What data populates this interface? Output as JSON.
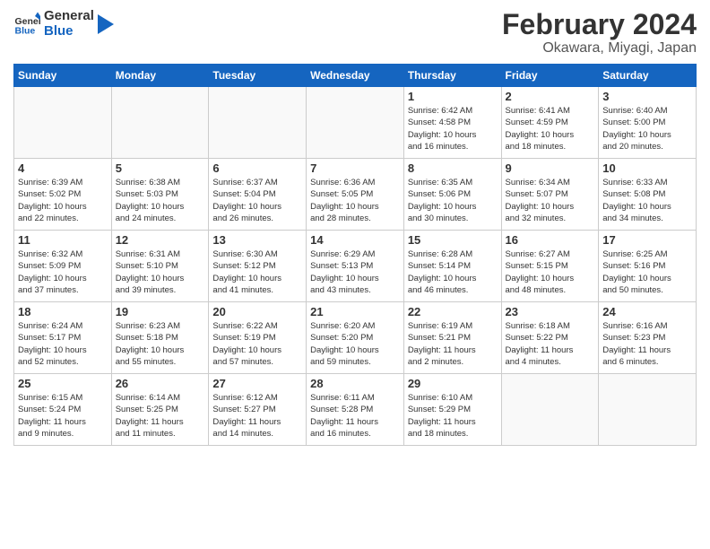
{
  "logo": {
    "line1": "General",
    "line2": "Blue"
  },
  "title": "February 2024",
  "subtitle": "Okawara, Miyagi, Japan",
  "weekdays": [
    "Sunday",
    "Monday",
    "Tuesday",
    "Wednesday",
    "Thursday",
    "Friday",
    "Saturday"
  ],
  "weeks": [
    [
      {
        "day": "",
        "info": ""
      },
      {
        "day": "",
        "info": ""
      },
      {
        "day": "",
        "info": ""
      },
      {
        "day": "",
        "info": ""
      },
      {
        "day": "1",
        "info": "Sunrise: 6:42 AM\nSunset: 4:58 PM\nDaylight: 10 hours\nand 16 minutes."
      },
      {
        "day": "2",
        "info": "Sunrise: 6:41 AM\nSunset: 4:59 PM\nDaylight: 10 hours\nand 18 minutes."
      },
      {
        "day": "3",
        "info": "Sunrise: 6:40 AM\nSunset: 5:00 PM\nDaylight: 10 hours\nand 20 minutes."
      }
    ],
    [
      {
        "day": "4",
        "info": "Sunrise: 6:39 AM\nSunset: 5:02 PM\nDaylight: 10 hours\nand 22 minutes."
      },
      {
        "day": "5",
        "info": "Sunrise: 6:38 AM\nSunset: 5:03 PM\nDaylight: 10 hours\nand 24 minutes."
      },
      {
        "day": "6",
        "info": "Sunrise: 6:37 AM\nSunset: 5:04 PM\nDaylight: 10 hours\nand 26 minutes."
      },
      {
        "day": "7",
        "info": "Sunrise: 6:36 AM\nSunset: 5:05 PM\nDaylight: 10 hours\nand 28 minutes."
      },
      {
        "day": "8",
        "info": "Sunrise: 6:35 AM\nSunset: 5:06 PM\nDaylight: 10 hours\nand 30 minutes."
      },
      {
        "day": "9",
        "info": "Sunrise: 6:34 AM\nSunset: 5:07 PM\nDaylight: 10 hours\nand 32 minutes."
      },
      {
        "day": "10",
        "info": "Sunrise: 6:33 AM\nSunset: 5:08 PM\nDaylight: 10 hours\nand 34 minutes."
      }
    ],
    [
      {
        "day": "11",
        "info": "Sunrise: 6:32 AM\nSunset: 5:09 PM\nDaylight: 10 hours\nand 37 minutes."
      },
      {
        "day": "12",
        "info": "Sunrise: 6:31 AM\nSunset: 5:10 PM\nDaylight: 10 hours\nand 39 minutes."
      },
      {
        "day": "13",
        "info": "Sunrise: 6:30 AM\nSunset: 5:12 PM\nDaylight: 10 hours\nand 41 minutes."
      },
      {
        "day": "14",
        "info": "Sunrise: 6:29 AM\nSunset: 5:13 PM\nDaylight: 10 hours\nand 43 minutes."
      },
      {
        "day": "15",
        "info": "Sunrise: 6:28 AM\nSunset: 5:14 PM\nDaylight: 10 hours\nand 46 minutes."
      },
      {
        "day": "16",
        "info": "Sunrise: 6:27 AM\nSunset: 5:15 PM\nDaylight: 10 hours\nand 48 minutes."
      },
      {
        "day": "17",
        "info": "Sunrise: 6:25 AM\nSunset: 5:16 PM\nDaylight: 10 hours\nand 50 minutes."
      }
    ],
    [
      {
        "day": "18",
        "info": "Sunrise: 6:24 AM\nSunset: 5:17 PM\nDaylight: 10 hours\nand 52 minutes."
      },
      {
        "day": "19",
        "info": "Sunrise: 6:23 AM\nSunset: 5:18 PM\nDaylight: 10 hours\nand 55 minutes."
      },
      {
        "day": "20",
        "info": "Sunrise: 6:22 AM\nSunset: 5:19 PM\nDaylight: 10 hours\nand 57 minutes."
      },
      {
        "day": "21",
        "info": "Sunrise: 6:20 AM\nSunset: 5:20 PM\nDaylight: 10 hours\nand 59 minutes."
      },
      {
        "day": "22",
        "info": "Sunrise: 6:19 AM\nSunset: 5:21 PM\nDaylight: 11 hours\nand 2 minutes."
      },
      {
        "day": "23",
        "info": "Sunrise: 6:18 AM\nSunset: 5:22 PM\nDaylight: 11 hours\nand 4 minutes."
      },
      {
        "day": "24",
        "info": "Sunrise: 6:16 AM\nSunset: 5:23 PM\nDaylight: 11 hours\nand 6 minutes."
      }
    ],
    [
      {
        "day": "25",
        "info": "Sunrise: 6:15 AM\nSunset: 5:24 PM\nDaylight: 11 hours\nand 9 minutes."
      },
      {
        "day": "26",
        "info": "Sunrise: 6:14 AM\nSunset: 5:25 PM\nDaylight: 11 hours\nand 11 minutes."
      },
      {
        "day": "27",
        "info": "Sunrise: 6:12 AM\nSunset: 5:27 PM\nDaylight: 11 hours\nand 14 minutes."
      },
      {
        "day": "28",
        "info": "Sunrise: 6:11 AM\nSunset: 5:28 PM\nDaylight: 11 hours\nand 16 minutes."
      },
      {
        "day": "29",
        "info": "Sunrise: 6:10 AM\nSunset: 5:29 PM\nDaylight: 11 hours\nand 18 minutes."
      },
      {
        "day": "",
        "info": ""
      },
      {
        "day": "",
        "info": ""
      }
    ]
  ]
}
